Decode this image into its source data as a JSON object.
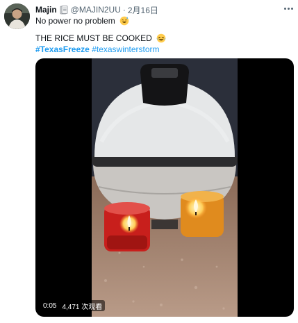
{
  "tweet": {
    "author": {
      "display_name": "Majin",
      "handle": "@MAJIN2UU",
      "separator": "·",
      "date": "2月16日",
      "badge_icon": "book-badge-icon"
    },
    "text": {
      "line1": "No power no problem",
      "line1_emoji": "sweat-smile-emoji",
      "line2": "THE RICE MUST BE COOKED",
      "line2_emoji": "laughing-tears-emoji",
      "hashtags": [
        "#TexasFreeze",
        "#texaswinterstorm"
      ]
    },
    "video": {
      "time": "0:05",
      "views": "4,471 次观看"
    },
    "colors": {
      "link": "#1d9bf0",
      "secondary_text": "#536471",
      "primary_text": "#0f1419"
    }
  }
}
